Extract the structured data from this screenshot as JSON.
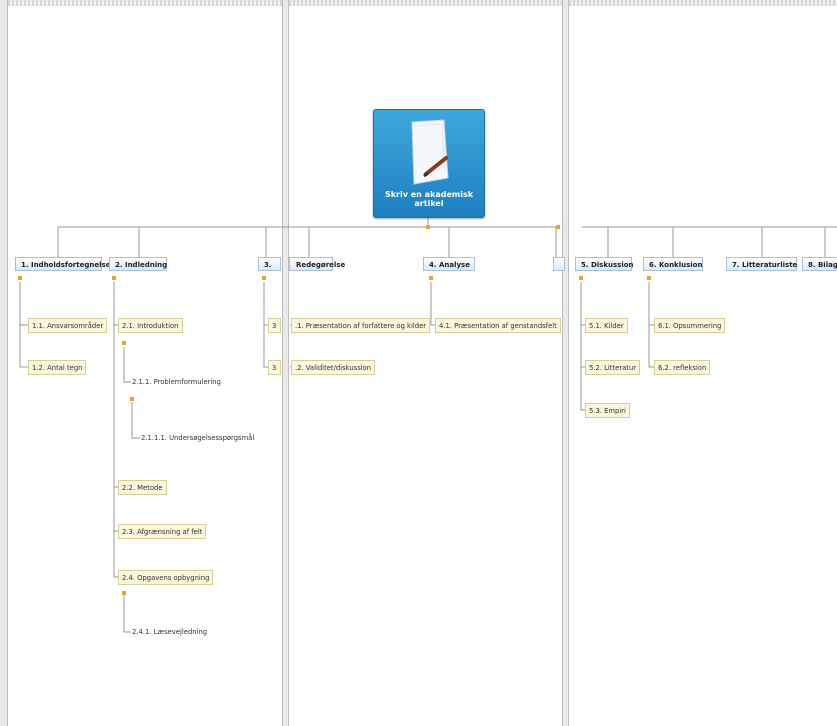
{
  "central": {
    "label": "Skriv en akademisk artikel",
    "icon": "document-pen-icon"
  },
  "topics": [
    {
      "label": "1.  Indholdsfortegnelse"
    },
    {
      "label": "2.  Indledning"
    },
    {
      "label": "3."
    },
    {
      "label": "Redegørelse"
    },
    {
      "label": "4.  Analyse"
    },
    {
      "label": "5.  Diskussion"
    },
    {
      "label": "6.  Konklusion"
    },
    {
      "label": "7.  Litteraturliste"
    },
    {
      "label": "8.  Bilag"
    }
  ],
  "subtopics": [
    {
      "label": "1.1.  Ansvarsområder"
    },
    {
      "label": "1.2.  Antal tegn"
    },
    {
      "label": "2.1.  Introduktion"
    },
    {
      "label": "2.2.  Metode"
    },
    {
      "label": "2.3.  Afgrænsning af felt"
    },
    {
      "label": "2.4.  Opgavens opbygning"
    },
    {
      "label": "3"
    },
    {
      "label": "3"
    },
    {
      "label": ".1.  Præsentation af forfattere og kilder"
    },
    {
      "label": ".2.  Validitet/diskussion"
    },
    {
      "label": "4.1.  Præsentation af genstandsfelt"
    },
    {
      "label": "5.1.  Kilder"
    },
    {
      "label": "5.2.  Litteratur"
    },
    {
      "label": "5.3.  Empiri"
    },
    {
      "label": "6.1.  Opsummering"
    },
    {
      "label": "6.2.  refleksion"
    }
  ],
  "leaves": [
    {
      "label": "2.1.1.  Problemformulering"
    },
    {
      "label": "2.1.1.1.  Undersøgelsesspørgsmål"
    },
    {
      "label": "2.4.1.  Læsevejledning"
    }
  ],
  "colors": {
    "central_top": "#3fa7dc",
    "central_bottom": "#1e7fc0",
    "topic_border": "#a8c3dd",
    "subtopic_fill": "#fbf6dc",
    "flag": "#e6a52b",
    "connector": "#9a9a9a"
  }
}
